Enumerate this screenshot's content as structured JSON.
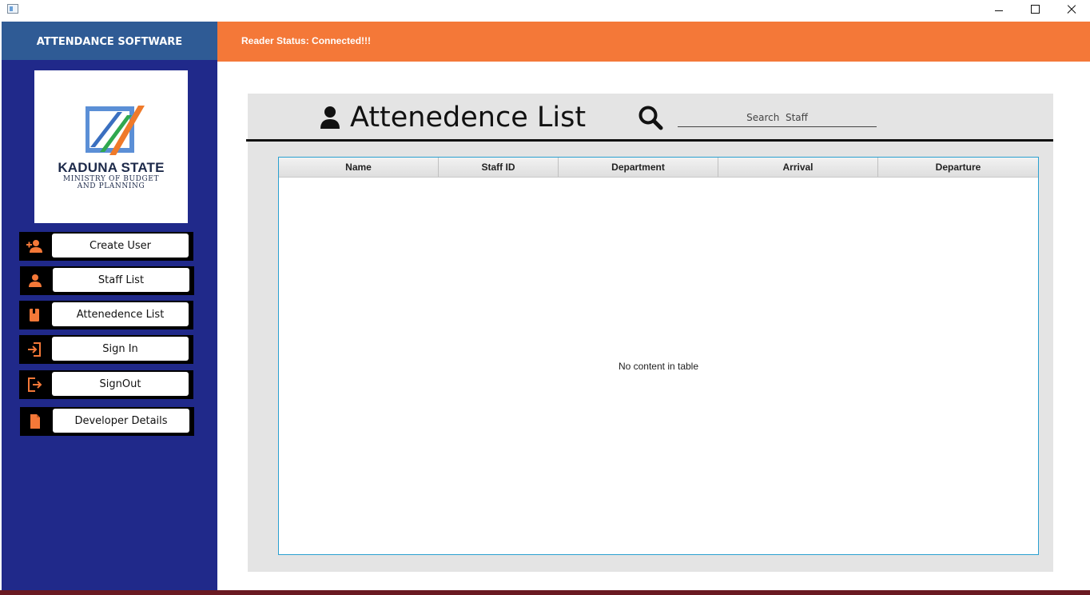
{
  "window": {
    "title_icon": "app-window-icon",
    "controls": [
      "minimize",
      "maximize",
      "close"
    ]
  },
  "sidebar": {
    "header": "ATTENDANCE SOFTWARE",
    "logo": {
      "title": "KADUNA STATE",
      "subtitle_line1": "MINISTRY OF BUDGET",
      "subtitle_line2": "AND PLANNING"
    },
    "items": [
      {
        "label": "Create User",
        "icon": "add-user-icon"
      },
      {
        "label": "Staff List",
        "icon": "person-icon"
      },
      {
        "label": "Attenedence List",
        "icon": "book-icon"
      },
      {
        "label": "Sign In",
        "icon": "sign-in-icon"
      },
      {
        "label": "SignOut",
        "icon": "sign-out-icon"
      },
      {
        "label": "Developer Details",
        "icon": "file-icon"
      }
    ]
  },
  "status": {
    "text": "Reader Status: Connected!!!"
  },
  "main": {
    "title": "Attenedence List",
    "search_placeholder": "Search  Staff",
    "table": {
      "columns": [
        "Name",
        "Staff ID",
        "Department",
        "Arrival",
        "Departure"
      ],
      "rows": [],
      "empty_message": "No content in table"
    }
  },
  "colors": {
    "sidebar": "#20298a",
    "sidebar_header": "#2f5b95",
    "accent": "#f47838",
    "table_border": "#2aa0d0"
  }
}
